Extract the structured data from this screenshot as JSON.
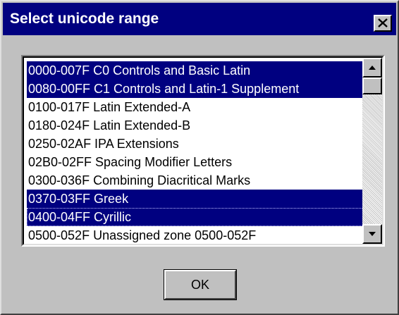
{
  "window": {
    "title": "Select unicode range",
    "colors": {
      "titlebar": "#000080",
      "face": "#c0c0c0",
      "selection": "#000080"
    }
  },
  "close_button": {
    "icon": "close-icon"
  },
  "range_list": {
    "items": [
      {
        "label": "0000-007F C0 Controls and Basic Latin",
        "selected": true
      },
      {
        "label": "0080-00FF C1 Controls and Latin-1 Supplement",
        "selected": true
      },
      {
        "label": "0100-017F Latin Extended-A",
        "selected": false
      },
      {
        "label": "0180-024F Latin Extended-B",
        "selected": false
      },
      {
        "label": "0250-02AF IPA Extensions",
        "selected": false
      },
      {
        "label": "02B0-02FF Spacing Modifier Letters",
        "selected": false
      },
      {
        "label": "0300-036F Combining Diacritical Marks",
        "selected": false
      },
      {
        "label": "0370-03FF Greek",
        "selected": true
      },
      {
        "label": "0400-04FF Cyrillic",
        "selected": true,
        "focused": true
      },
      {
        "label": "0500-052F Unassigned zone 0500-052F",
        "selected": false
      }
    ],
    "scrollbar": {
      "up_icon": "arrow-up-icon",
      "down_icon": "arrow-down-icon",
      "position": 0
    }
  },
  "ok_button": {
    "label": "OK"
  }
}
